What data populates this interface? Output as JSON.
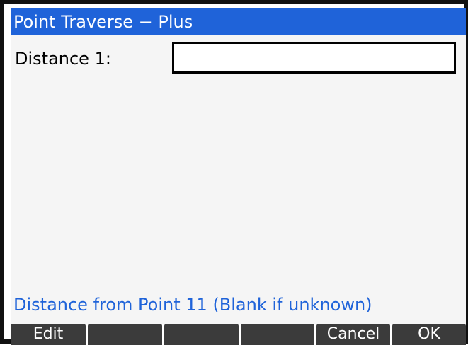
{
  "window": {
    "title": "Point Traverse − Plus"
  },
  "form": {
    "field_label": "Distance 1:",
    "field_value": "",
    "help_text": "Distance from Point 11 (Blank if unknown)"
  },
  "softkeys": [
    "Edit",
    "",
    "",
    "",
    "Cancel",
    "OK"
  ],
  "colors": {
    "title_bar": "#1f63d9",
    "help_text": "#1f63d9",
    "softkey_background": "#3b3b3b",
    "form_background": "#f5f5f5"
  }
}
